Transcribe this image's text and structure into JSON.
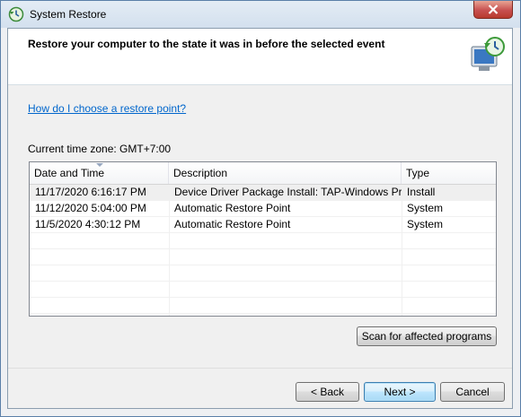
{
  "window": {
    "title": "System Restore"
  },
  "header": {
    "text": "Restore your computer to the state it was in before the selected event"
  },
  "help_link": "How do I choose a restore point?",
  "timezone_label": "Current time zone: GMT+7:00",
  "table": {
    "columns": [
      "Date and Time",
      "Description",
      "Type"
    ],
    "rows": [
      {
        "date": "11/17/2020 6:16:17 PM",
        "description": "Device Driver Package Install: TAP-Windows Pro...",
        "type": "Install",
        "selected": true
      },
      {
        "date": "11/12/2020 5:04:00 PM",
        "description": "Automatic Restore Point",
        "type": "System",
        "selected": false
      },
      {
        "date": "11/5/2020 4:30:12 PM",
        "description": "Automatic Restore Point",
        "type": "System",
        "selected": false
      }
    ]
  },
  "buttons": {
    "scan": "Scan for affected programs",
    "back": "< Back",
    "next": "Next >",
    "cancel": "Cancel"
  },
  "colors": {
    "link": "#0066cc",
    "close_button": "#c75050",
    "selected_row": "#efefef"
  }
}
